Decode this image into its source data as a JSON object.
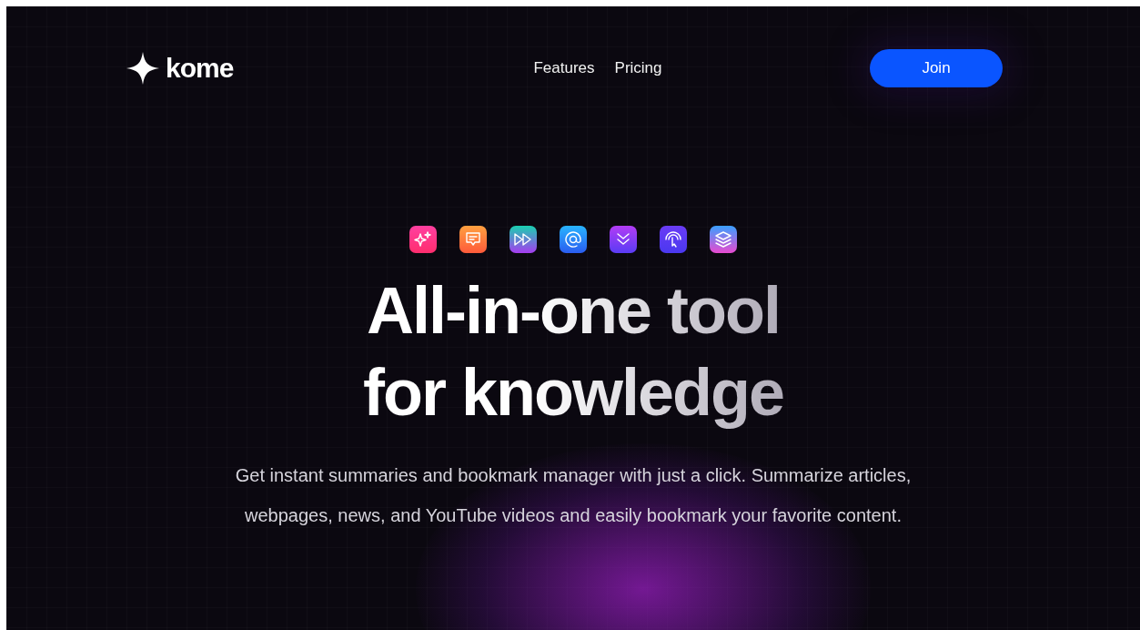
{
  "brand": {
    "name": "kome"
  },
  "nav": {
    "links": [
      "Features",
      "Pricing"
    ],
    "button": "Join"
  },
  "hero": {
    "icons": [
      {
        "kind": "sparkles"
      },
      {
        "kind": "chat"
      },
      {
        "kind": "forward"
      },
      {
        "kind": "at"
      },
      {
        "kind": "chevrons"
      },
      {
        "kind": "tap"
      },
      {
        "kind": "layers"
      }
    ],
    "title_lines": [
      "All-in-one tool",
      "for knowledge"
    ],
    "subtitle": "Get instant summaries and bookmark manager with just a click. Summarize articles, webpages, news, and YouTube videos and easily bookmark your favorite content."
  }
}
